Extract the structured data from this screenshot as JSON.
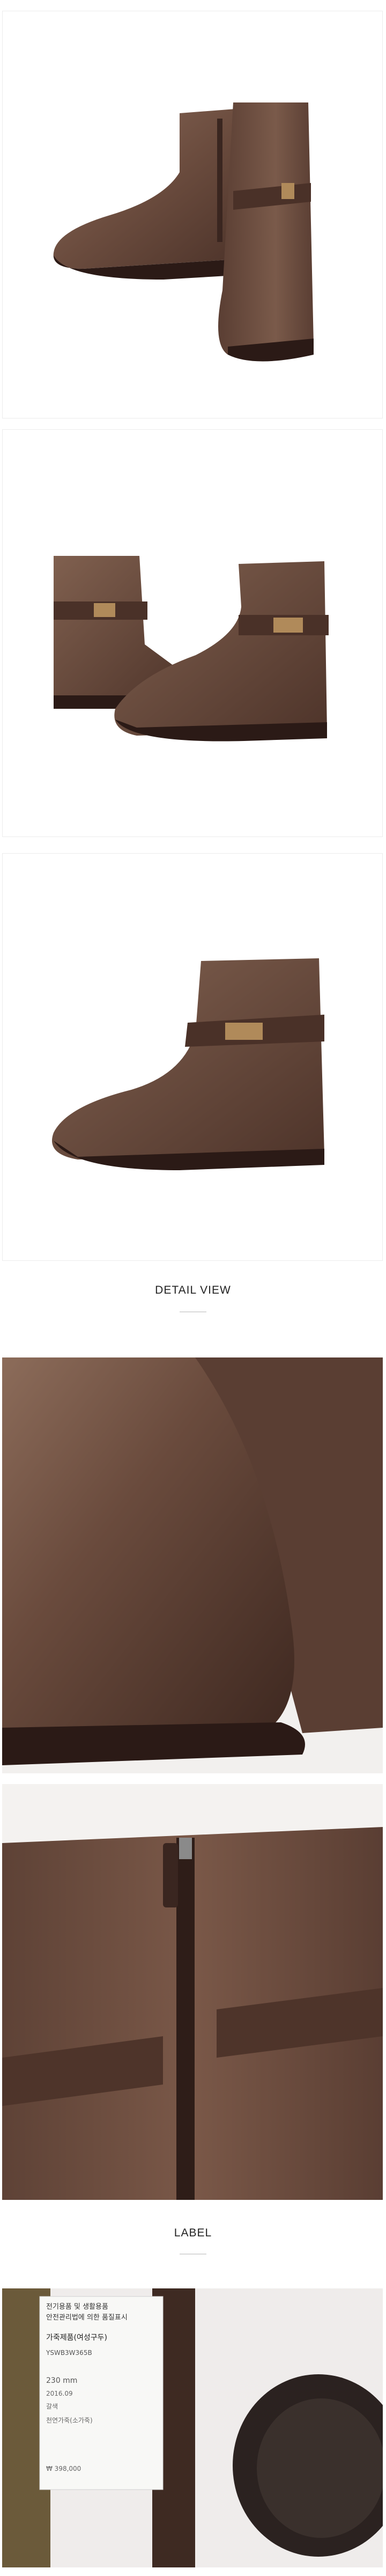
{
  "sections": {
    "detail_view": "DETAIL VIEW",
    "label": "LABEL"
  },
  "label_tag": {
    "lines": [
      "전기용품 및 생활용품",
      "안전관리법에 의한 품질표시",
      "가죽제품(여성구두)",
      "YSWB3W365B",
      "230 mm",
      "2016.09",
      "갈색",
      "천연가죽(소가죽)",
      "₩ 398,000"
    ]
  },
  "colors": {
    "leather": "#6b4c3e",
    "leather_dark": "#3a2620",
    "buckle": "#b08a5a",
    "sole": "#2b1a16"
  }
}
